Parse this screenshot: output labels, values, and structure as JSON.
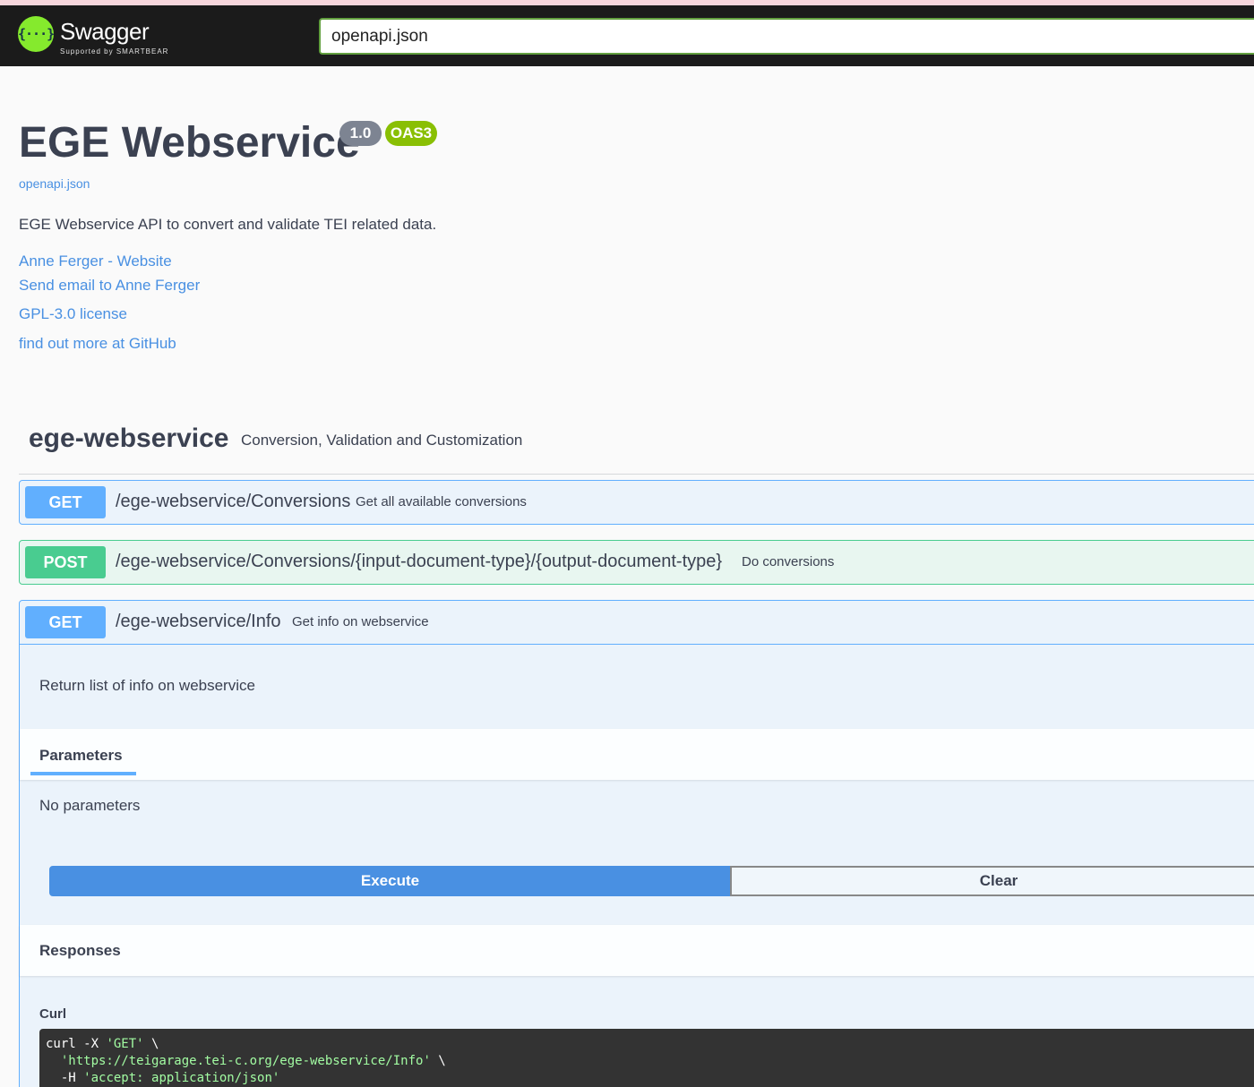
{
  "header": {
    "logo_glyph": "{···}",
    "logo_title": "Swagger",
    "logo_subtitle": "Supported by SMARTBEAR",
    "url_value": "openapi.json"
  },
  "info": {
    "title": "EGE Webservice",
    "version_badge": "1.0",
    "oas_badge": "OAS3",
    "spec_link": "openapi.json",
    "description": "EGE Webservice API to convert and validate TEI related data.",
    "links": {
      "website": "Anne Ferger - Website",
      "email": "Send email to Anne Ferger",
      "license": "GPL-3.0 license",
      "github": "find out more at GitHub"
    }
  },
  "tag": {
    "name": "ege-webservice",
    "description": "Conversion, Validation and Customization"
  },
  "operations": [
    {
      "method": "GET",
      "path": "/ege-webservice/Conversions",
      "summary": "Get all available conversions"
    },
    {
      "method": "POST",
      "path": "/ege-webservice/Conversions/{input-document-type}/{output-document-type}",
      "summary": "Do conversions"
    },
    {
      "method": "GET",
      "path": "/ege-webservice/Info",
      "summary": "Get info on webservice"
    }
  ],
  "expanded": {
    "description": "Return list of info on webservice",
    "parameters_tab": "Parameters",
    "no_parameters": "No parameters",
    "execute_label": "Execute",
    "clear_label": "Clear",
    "responses_title": "Responses",
    "curl_label": "Curl",
    "curl": {
      "l1_cmd": "curl -X ",
      "l1_str": "'GET'",
      "l1_end": " \\",
      "l2_indent": "  ",
      "l2_str": "'https://teigarage.tei-c.org/ege-webservice/Info'",
      "l2_end": " \\",
      "l3_cmd": "  -H ",
      "l3_str": "'accept: application/json'"
    }
  },
  "colors": {
    "get": "#61affe",
    "post": "#49cc90",
    "execute": "#4990e2",
    "link": "#4990e2",
    "logo_green": "#85ea2d"
  }
}
